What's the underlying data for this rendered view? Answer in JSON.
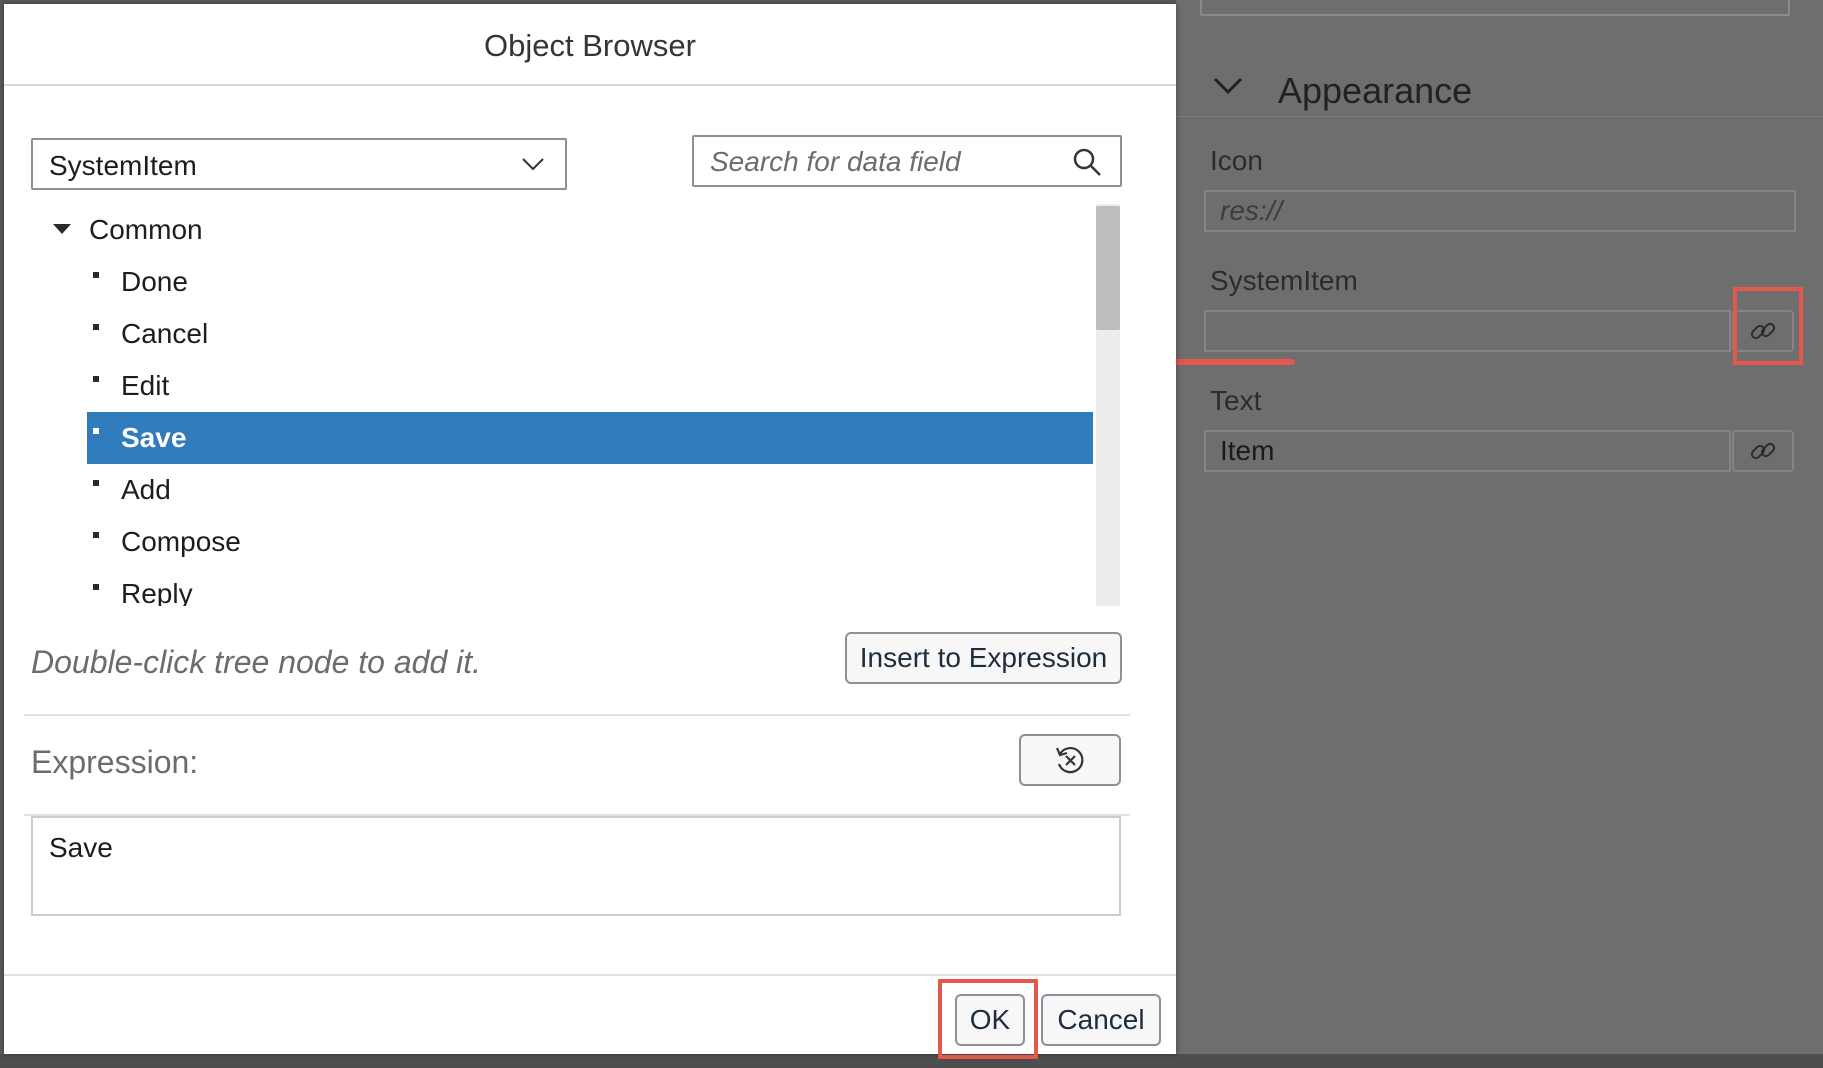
{
  "dialog": {
    "title": "Object Browser",
    "type_select": {
      "value": "SystemItem"
    },
    "search": {
      "placeholder": "Search for data field"
    },
    "tree": {
      "root": "Common",
      "items": [
        "Done",
        "Cancel",
        "Edit",
        "Save",
        "Add",
        "Compose",
        "Reply"
      ],
      "selected": "Save"
    },
    "hint": "Double-click tree node to add it.",
    "insert_button": "Insert to Expression",
    "expression_label": "Expression:",
    "expression_value": "Save",
    "ok_button": "OK",
    "cancel_button": "Cancel"
  },
  "properties_panel": {
    "section_title": "Appearance",
    "icon_label": "Icon",
    "icon_placeholder": "res://",
    "systemitem_label": "SystemItem",
    "systemitem_value": "",
    "text_label": "Text",
    "text_value": "Item"
  },
  "colors": {
    "selection": "#2f7bbc",
    "annotation": "#e4584c",
    "overlay": "#6e6e6e"
  }
}
